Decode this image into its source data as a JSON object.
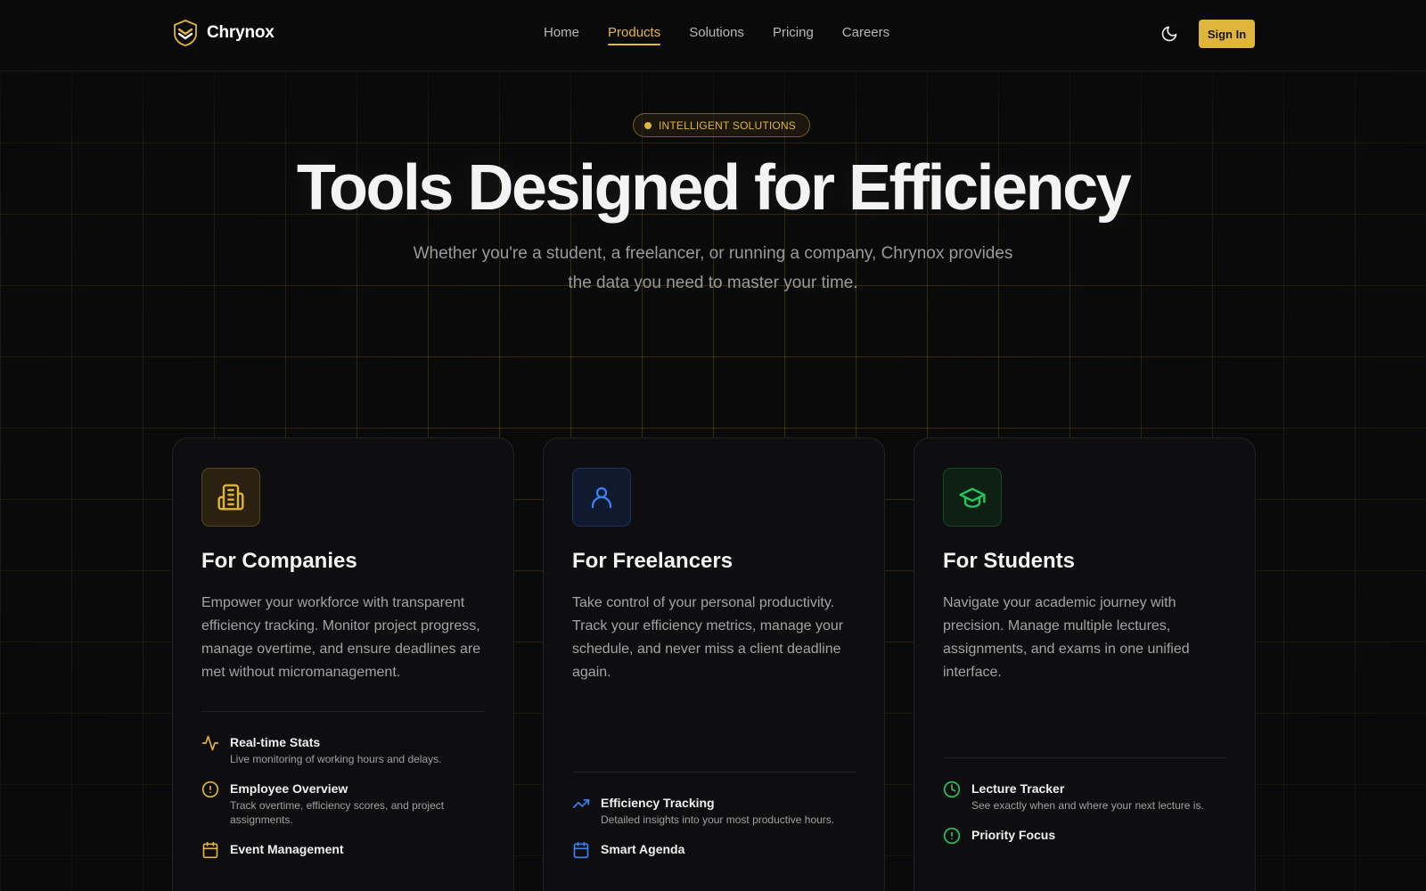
{
  "brand": {
    "name": "Chrynox"
  },
  "nav": {
    "items": [
      {
        "label": "Home"
      },
      {
        "label": "Products"
      },
      {
        "label": "Solutions"
      },
      {
        "label": "Pricing"
      },
      {
        "label": "Careers"
      }
    ],
    "active": "Products"
  },
  "header": {
    "theme_icon": "moon-icon",
    "signin_label": "Sign In"
  },
  "hero": {
    "badge": "INTELLIGENT SOLUTIONS",
    "title": "Tools Designed for Efficiency",
    "subtitle_line1": "Whether you're a student, a freelancer, or running a company, Chrynox provides",
    "subtitle_line2": "the data you need to master your time."
  },
  "colors": {
    "accent_gold": "#e0b53c",
    "accent_blue": "#3b82f6",
    "accent_green": "#22c55e",
    "background": "#0a0a0b"
  },
  "cards": [
    {
      "icon": "building-icon",
      "title": "For Companies",
      "description": "Empower your workforce with transparent efficiency tracking. Monitor project progress, manage overtime, and ensure deadlines are met without micromanagement.",
      "features": [
        {
          "icon": "activity-icon",
          "title": "Real-time Stats",
          "desc": "Live monitoring of working hours and delays."
        },
        {
          "icon": "alert-circle-icon",
          "title": "Employee Overview",
          "desc": "Track overtime, efficiency scores, and project assignments."
        },
        {
          "icon": "calendar-icon",
          "title": "Event Management",
          "desc": ""
        }
      ]
    },
    {
      "icon": "user-icon",
      "title": "For Freelancers",
      "description": "Take control of your personal productivity. Track your efficiency metrics, manage your schedule, and never miss a client deadline again.",
      "features": [
        {
          "icon": "trending-up-icon",
          "title": "Efficiency Tracking",
          "desc": "Detailed insights into your most productive hours."
        },
        {
          "icon": "calendar-icon",
          "title": "Smart Agenda",
          "desc": ""
        }
      ]
    },
    {
      "icon": "graduation-cap-icon",
      "title": "For Students",
      "description": "Navigate your academic journey with precision. Manage multiple lectures, assignments, and exams in one unified interface.",
      "features": [
        {
          "icon": "clock-icon",
          "title": "Lecture Tracker",
          "desc": "See exactly when and where your next lecture is."
        },
        {
          "icon": "alert-circle-icon",
          "title": "Priority Focus",
          "desc": ""
        }
      ]
    }
  ]
}
